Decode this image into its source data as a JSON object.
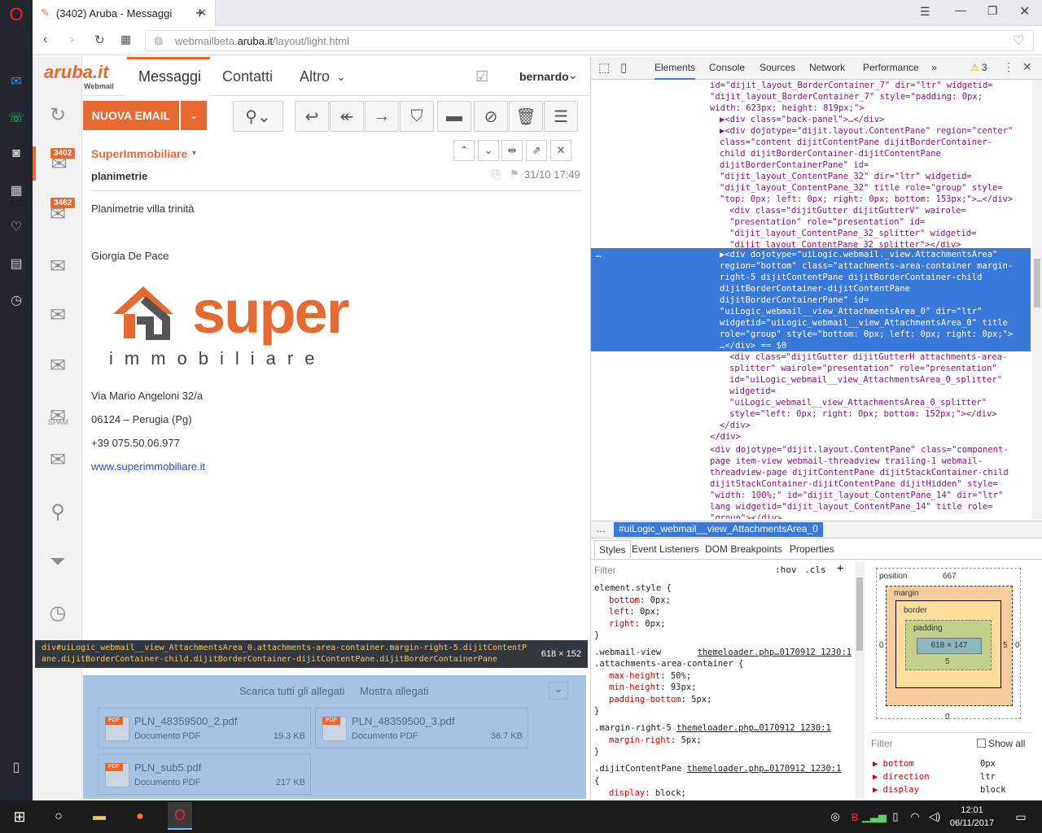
{
  "browser": {
    "tab_title": "(3402) Aruba - Messaggi",
    "url_prefix": "webmailbeta.",
    "url_domain": "aruba.it",
    "url_path": "/layout/light.html"
  },
  "webmail": {
    "logo_text": "aruba.it",
    "logo_sub": "Webmail",
    "nav_tabs": [
      "Messaggi",
      "Contatti",
      "Altro"
    ],
    "user": "bernardo",
    "compose_label": "NUOVA EMAIL",
    "badges": {
      "inbox": "3402",
      "folders": "3462"
    },
    "spam_label": "SPAM",
    "message": {
      "sender": "SuperImmobiliare",
      "subject": "planimetrie",
      "date": "31/10 17:49",
      "body_line1": "Planimetrie villa trinità",
      "signature_name": "Giorgia De Pace",
      "logo_word": "super",
      "logo_sub": "immobiliare",
      "address1": "Via Mario Angeloni 32/a",
      "address2": "06124 – Perugia (Pg)",
      "phone": "+39 075.50.06.977",
      "website": "www.superimmobiliare.it"
    },
    "tooltip": {
      "selector_line1": "div#uiLogic_webmail__view_AttachmentsArea_0.attachments-area-container.margin-right-5.dijitContentP",
      "selector_line2": "ane.dijitBorderContainer-child.dijitBorderContainer-dijitContentPane.dijitBorderContainerPane",
      "size": "618 × 152"
    },
    "attachments": {
      "download_all": "Scarica tutti gli allegati",
      "show": "Mostra allegati",
      "files": [
        {
          "name": "PLN_48359500_2.pdf",
          "type": "Documento PDF",
          "size": "19.3 KB"
        },
        {
          "name": "PLN_48359500_3.pdf",
          "type": "Documento PDF",
          "size": "36.7 KB"
        },
        {
          "name": "PLN_sub5.pdf",
          "type": "Documento PDF",
          "size": "217 KB"
        }
      ]
    }
  },
  "devtools": {
    "tabs": [
      "Elements",
      "Console",
      "Sources",
      "Network",
      "Performance",
      "»"
    ],
    "warnings": "3",
    "breadcrumb": "#uiLogic_webmail__view_AttachmentsArea_0",
    "style_tabs": [
      "Styles",
      "Event Listeners",
      "DOM Breakpoints",
      "Properties"
    ],
    "filter": "Filter",
    "hov": ":hov",
    "cls": ".cls",
    "computed_filter": "Filter",
    "show_all": "Show all",
    "box": {
      "position": "position",
      "position_val": "667",
      "margin": "margin",
      "border": "border",
      "padding": "padding",
      "content": "618 × 147",
      "dash": "–",
      "zero": "0",
      "five": "5"
    },
    "computed": [
      {
        "prop": "bottom",
        "val": "0px"
      },
      {
        "prop": "direction",
        "val": "ltr"
      },
      {
        "prop": "display",
        "val": "block"
      }
    ]
  },
  "taskbar": {
    "time": "12:01",
    "date": "06/11/2017"
  }
}
